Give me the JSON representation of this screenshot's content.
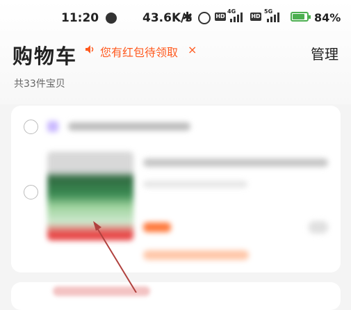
{
  "status_bar": {
    "time": "11:20",
    "net_speed": "43.6K/s",
    "net1_label": "4G",
    "net2_label": "5G",
    "hd_label": "HD",
    "battery_percent_text": "84%",
    "battery_level": 0.84,
    "icons": [
      "globe-icon",
      "bluetooth-icon",
      "alarm-icon",
      "hd-icon",
      "signal-icon",
      "battery-icon"
    ]
  },
  "header": {
    "title": "购物车",
    "promo_text": "您有红包待领取",
    "promo_close": "×",
    "manage_label": "管理"
  },
  "summary": {
    "item_count_text": "共33件宝贝"
  },
  "colors": {
    "accent": "#ff5a1f",
    "annotation_arrow": "#b0413e"
  }
}
